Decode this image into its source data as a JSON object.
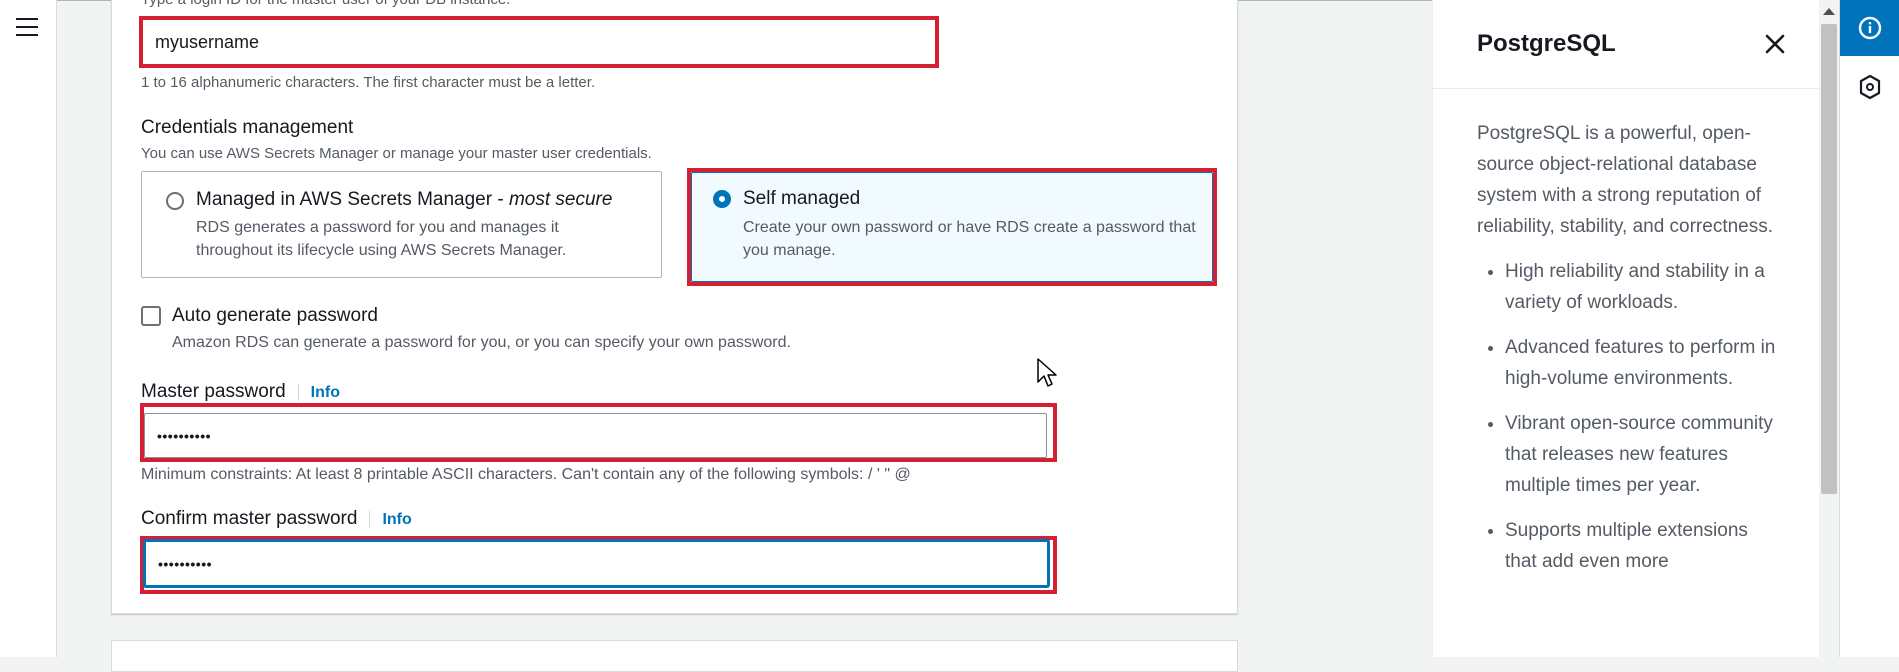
{
  "nav": {
    "menu_icon": "hamburger-menu-icon"
  },
  "form": {
    "master_username": {
      "description": "Type a login ID for the master user of your DB instance.",
      "value": "myusername",
      "constraint": "1 to 16 alphanumeric characters. The first character must be a letter."
    },
    "credentials": {
      "label": "Credentials management",
      "description": "You can use AWS Secrets Manager or manage your master user credentials.",
      "options": [
        {
          "title_main": "Managed in AWS Secrets Manager - ",
          "title_emph": "most secure",
          "desc": "RDS generates a password for you and manages it throughout its lifecycle using AWS Secrets Manager.",
          "selected": false
        },
        {
          "title_main": "Self managed",
          "desc": "Create your own password or have RDS create a password that you manage.",
          "selected": true
        }
      ]
    },
    "auto_generate": {
      "label": "Auto generate password",
      "desc": "Amazon RDS can generate a password for you, or you can specify your own password.",
      "checked": false
    },
    "master_password": {
      "label": "Master password",
      "info": "Info",
      "value": "••••••••••",
      "constraint": "Minimum constraints: At least 8 printable ASCII characters. Can't contain any of the following symbols: / ' \" @"
    },
    "confirm_password": {
      "label": "Confirm master password",
      "info": "Info",
      "value": "••••••••••"
    }
  },
  "help_panel": {
    "title": "PostgreSQL",
    "intro": "PostgreSQL is a powerful, open-source object-relational database system with a strong reputation of reliability, stability, and correctness.",
    "bullets": [
      "High reliability and stability in a variety of workloads.",
      "Advanced features to perform in high-volume environments.",
      "Vibrant open-source community that releases new features multiple times per year.",
      "Supports multiple extensions that add even more"
    ]
  },
  "colors": {
    "accent": "#0073bb",
    "highlight": "#d51f35"
  }
}
